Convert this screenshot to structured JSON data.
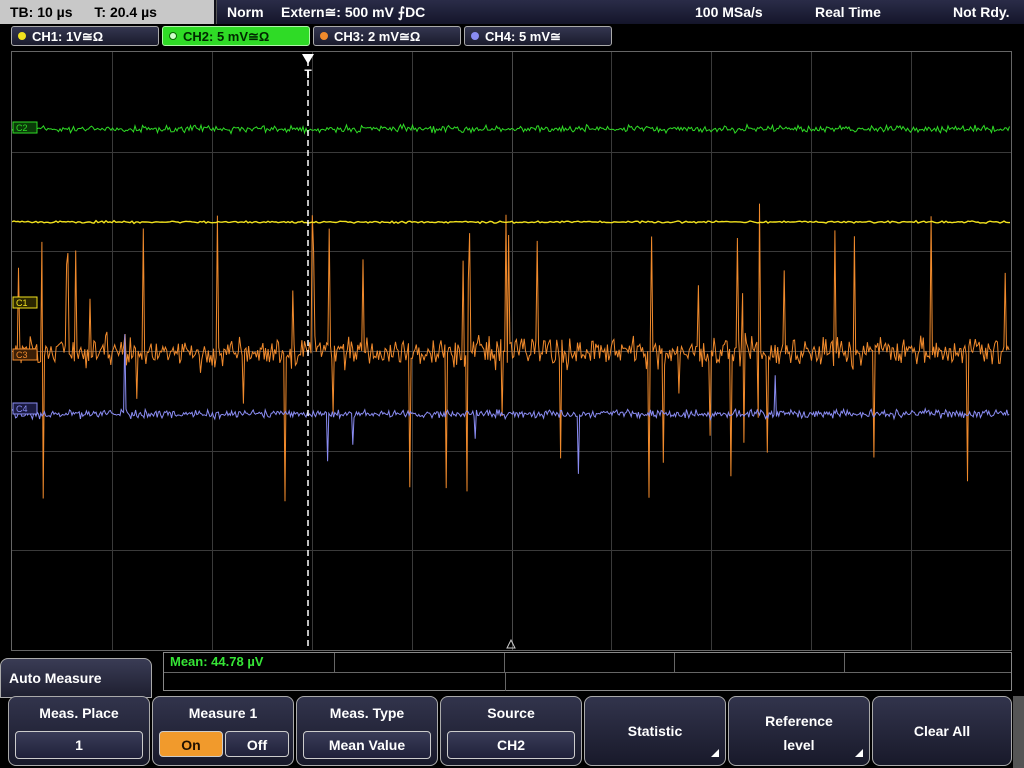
{
  "topbar": {
    "timebase": "TB: 10 µs",
    "trigger_time": "T: 20.4 µs",
    "mode": "Norm",
    "trigger_source": "Extern≅: 500 mV ⨍DC",
    "sample_rate": "100 MSa/s",
    "acq_mode": "Real Time",
    "status": "Not Rdy."
  },
  "channels": [
    {
      "label": "CH1: 1V≅Ω",
      "color": "#f2e21e"
    },
    {
      "label": "CH2: 5 mV≅Ω",
      "color": "#2fdb26"
    },
    {
      "label": "CH3: 2 mV≅Ω",
      "color": "#f08a2c"
    },
    {
      "label": "CH4: 5 mV≅",
      "color": "#8a8cf2"
    }
  ],
  "markers": {
    "c1": "C1",
    "c2": "C2",
    "c3": "C3",
    "c4": "C4",
    "trigger": "T"
  },
  "measurement": {
    "readout": "Mean: 44.78 µV"
  },
  "menu": {
    "title": "Auto Measure",
    "meas_place": {
      "label": "Meas. Place",
      "value": "1"
    },
    "measure1": {
      "label": "Measure 1",
      "on": "On",
      "off": "Off"
    },
    "meas_type": {
      "label": "Meas. Type",
      "value": "Mean Value"
    },
    "source": {
      "label": "Source",
      "value": "CH2"
    },
    "statistic": {
      "label": "Statistic"
    },
    "reference": {
      "label_1": "Reference",
      "label_2": "level"
    },
    "clear_all": {
      "label": "Clear All"
    }
  }
}
